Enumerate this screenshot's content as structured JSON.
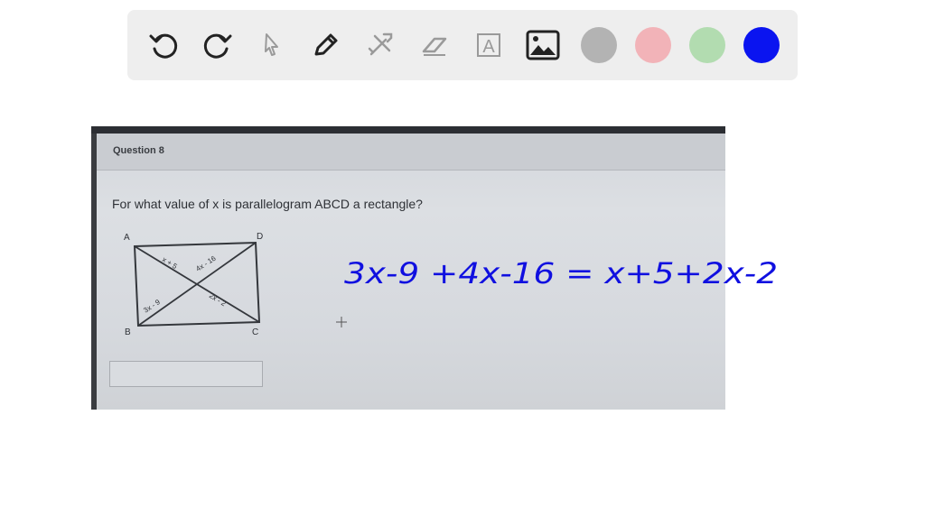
{
  "toolbar": {
    "tools": [
      {
        "name": "undo-icon"
      },
      {
        "name": "redo-icon"
      },
      {
        "name": "pointer-icon"
      },
      {
        "name": "pen-icon"
      },
      {
        "name": "tools-icon"
      },
      {
        "name": "eraser-icon"
      },
      {
        "name": "text-icon",
        "glyph": "A"
      },
      {
        "name": "image-icon"
      }
    ],
    "colors": [
      "#b3b3b3",
      "#f2b3b8",
      "#b2dcb0",
      "#0a14f0"
    ]
  },
  "screenshot": {
    "question_label": "Question 8",
    "question_text": "For what value of x is parallelogram ABCD a rectangle?",
    "diagram": {
      "vertices": [
        "A",
        "D",
        "B",
        "C"
      ],
      "segment_labels": [
        "x + 5",
        "4x - 16",
        "3x - 9",
        "2x - 2"
      ]
    }
  },
  "handwriting": {
    "equation": "3x-9 +4x-16 = x+5+2x-2",
    "color": "#1010e0"
  }
}
